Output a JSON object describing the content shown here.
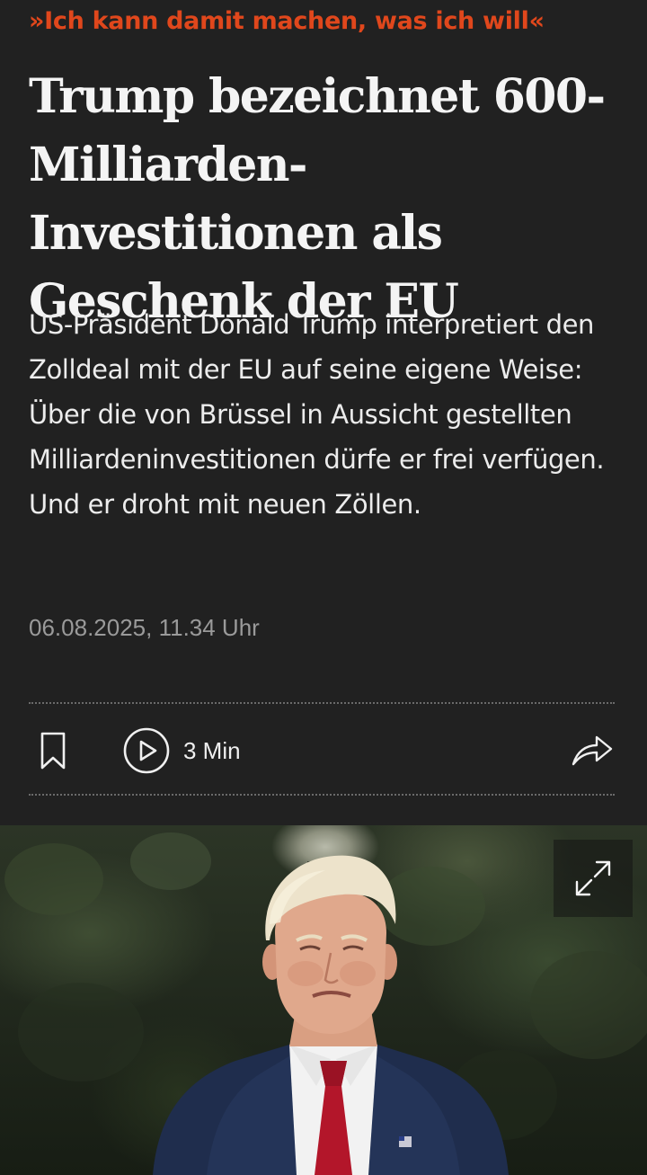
{
  "article": {
    "kicker": "»Ich kann damit machen, was ich will«",
    "headline": "Trump bezeichnet 600-Milliarden-Investitionen als Geschenk der EU",
    "teaser": "US-Präsident Donald Trump interpretiert den Zolldeal mit der EU auf seine eigene Weise: Über die von Brüssel in Aussicht gestellten Milliardeninvestitionen dürfe er frei verfügen. Und er droht mit neuen Zöllen.",
    "timestamp": "06.08.2025, 11.34 Uhr"
  },
  "toolbar": {
    "bookmark_icon": "bookmark-icon",
    "audio_icon": "play-circle-icon",
    "audio_duration": "3 Min",
    "share_icon": "share-arrow-icon"
  },
  "hero": {
    "expand_icon": "expand-icon"
  },
  "colors": {
    "background": "#212121",
    "kicker": "#e0471c",
    "text": "#f4f4f4",
    "meta": "#9a9a9a"
  }
}
